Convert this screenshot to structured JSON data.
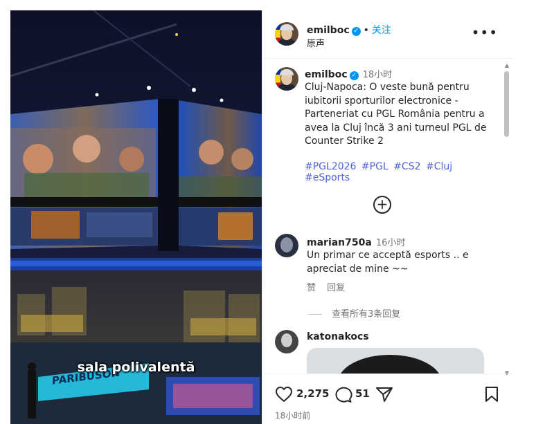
{
  "video": {
    "caption": "sala polivalentă",
    "banner_text": "PARIBUSON"
  },
  "header": {
    "username": "emilboc",
    "verified_mark": "✓",
    "separator": "•",
    "follow_label": "关注",
    "subtitle": "原声",
    "more_icon": "more-options-icon",
    "more_label": "•••"
  },
  "post": {
    "username": "emilboc",
    "verified_mark": "✓",
    "time": "18小时",
    "text": "Cluj-Napoca: O veste bună pentru iubitorii sporturilor electronice - Parteneriat cu PGL România pentru a avea la Cluj încă 3 ani turneul PGL de Counter Strike 2",
    "hashtags": [
      "#PGL2026",
      "#PGL",
      "#CS2",
      "#Cluj",
      "#eSports"
    ],
    "add_label": "+"
  },
  "comments": [
    {
      "username": "marian750a",
      "time": "16小时",
      "text": "Un primar ce acceptă esports .. e apreciat de mine ~~",
      "like_label": "赞",
      "reply_label": "回复",
      "view_replies": "查看所有3条回复"
    },
    {
      "username": "katonakocs"
    }
  ],
  "actions": {
    "likes": "2,275",
    "comments": "51",
    "date": "18小时前"
  },
  "colors": {
    "accent": "#0095f6",
    "hashtag": "#4f5fd8",
    "muted": "#737373"
  }
}
